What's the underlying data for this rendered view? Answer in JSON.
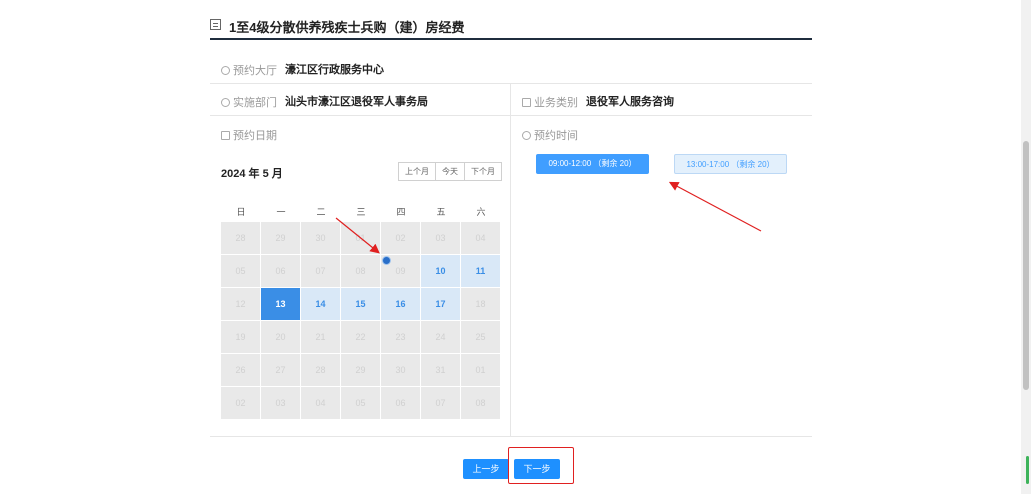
{
  "header": {
    "title": "1至4级分散供养残疾士兵购（建）房经费"
  },
  "info": {
    "hall_label": "预约大厅",
    "hall_value": "濠江区行政服务中心",
    "dept_label": "实施部门",
    "dept_value": "汕头市濠江区退役军人事务局",
    "type_label": "业务类别",
    "type_value": "退役军人服务咨询",
    "date_label": "预约日期",
    "time_label": "预约时间"
  },
  "calendar": {
    "month_label": "2024 年 5 月",
    "prev_month": "上个月",
    "today": "今天",
    "next_month": "下个月",
    "weekdays": [
      "日",
      "一",
      "二",
      "三",
      "四",
      "五",
      "六"
    ],
    "days": [
      {
        "d": "28",
        "s": "off"
      },
      {
        "d": "29",
        "s": "off"
      },
      {
        "d": "30",
        "s": "off"
      },
      {
        "d": "01",
        "s": "off"
      },
      {
        "d": "02",
        "s": "off"
      },
      {
        "d": "03",
        "s": "off"
      },
      {
        "d": "04",
        "s": "off"
      },
      {
        "d": "05",
        "s": "off"
      },
      {
        "d": "06",
        "s": "off"
      },
      {
        "d": "07",
        "s": "off"
      },
      {
        "d": "08",
        "s": "off"
      },
      {
        "d": "09",
        "s": "off"
      },
      {
        "d": "10",
        "s": "avail"
      },
      {
        "d": "11",
        "s": "avail"
      },
      {
        "d": "12",
        "s": "off"
      },
      {
        "d": "13",
        "s": "sel"
      },
      {
        "d": "14",
        "s": "avail"
      },
      {
        "d": "15",
        "s": "avail"
      },
      {
        "d": "16",
        "s": "avail"
      },
      {
        "d": "17",
        "s": "avail"
      },
      {
        "d": "18",
        "s": "off"
      },
      {
        "d": "19",
        "s": "off"
      },
      {
        "d": "20",
        "s": "off"
      },
      {
        "d": "21",
        "s": "off"
      },
      {
        "d": "22",
        "s": "off"
      },
      {
        "d": "23",
        "s": "off"
      },
      {
        "d": "24",
        "s": "off"
      },
      {
        "d": "25",
        "s": "off"
      },
      {
        "d": "26",
        "s": "off"
      },
      {
        "d": "27",
        "s": "off"
      },
      {
        "d": "28",
        "s": "off"
      },
      {
        "d": "29",
        "s": "off"
      },
      {
        "d": "30",
        "s": "off"
      },
      {
        "d": "31",
        "s": "off"
      },
      {
        "d": "01",
        "s": "off"
      },
      {
        "d": "02",
        "s": "off"
      },
      {
        "d": "03",
        "s": "off"
      },
      {
        "d": "04",
        "s": "off"
      },
      {
        "d": "05",
        "s": "off"
      },
      {
        "d": "06",
        "s": "off"
      },
      {
        "d": "07",
        "s": "off"
      },
      {
        "d": "08",
        "s": "off"
      }
    ]
  },
  "slots": [
    {
      "label": "09:00-12:00 （剩余 20）"
    },
    {
      "label": "13:00-17:00 （剩余 20）"
    }
  ],
  "buttons": {
    "prev": "上一步",
    "next": "下一步"
  },
  "colors": {
    "accent": "#409eff",
    "annotation": "#e02020"
  }
}
